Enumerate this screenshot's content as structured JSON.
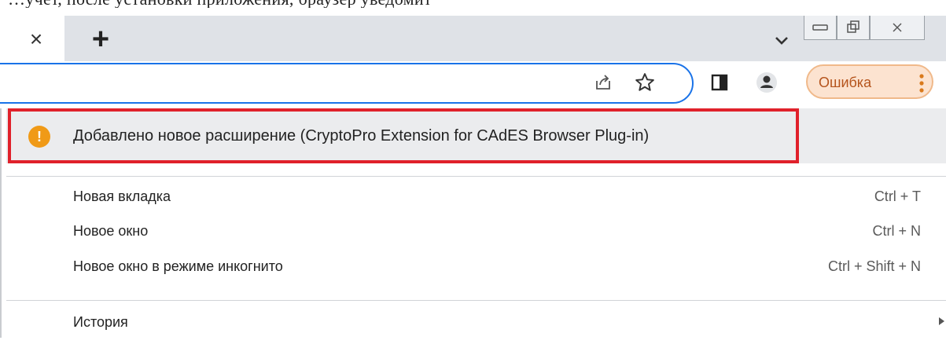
{
  "caption": "…учет, после установки приложения, браузер уведомит",
  "tabstrip": {
    "close_glyph": "×",
    "new_tab_glyph": "+"
  },
  "toolbar": {
    "error_label": "Ошибка"
  },
  "menu": {
    "extension_notice": "Добавлено новое расширение (CryptoPro Extension for CAdES Browser Plug-in)",
    "items": [
      {
        "label": "Новая вкладка",
        "shortcut": "Ctrl + T"
      },
      {
        "label": "Новое окно",
        "shortcut": "Ctrl + N"
      },
      {
        "label": "Новое окно в режиме инкогнито",
        "shortcut": "Ctrl + Shift + N"
      },
      {
        "label": "История",
        "shortcut": ""
      }
    ]
  },
  "colors": {
    "accent_blue": "#1a73e8",
    "error_orange": "#f09a17",
    "highlight_red": "#e0212b"
  }
}
